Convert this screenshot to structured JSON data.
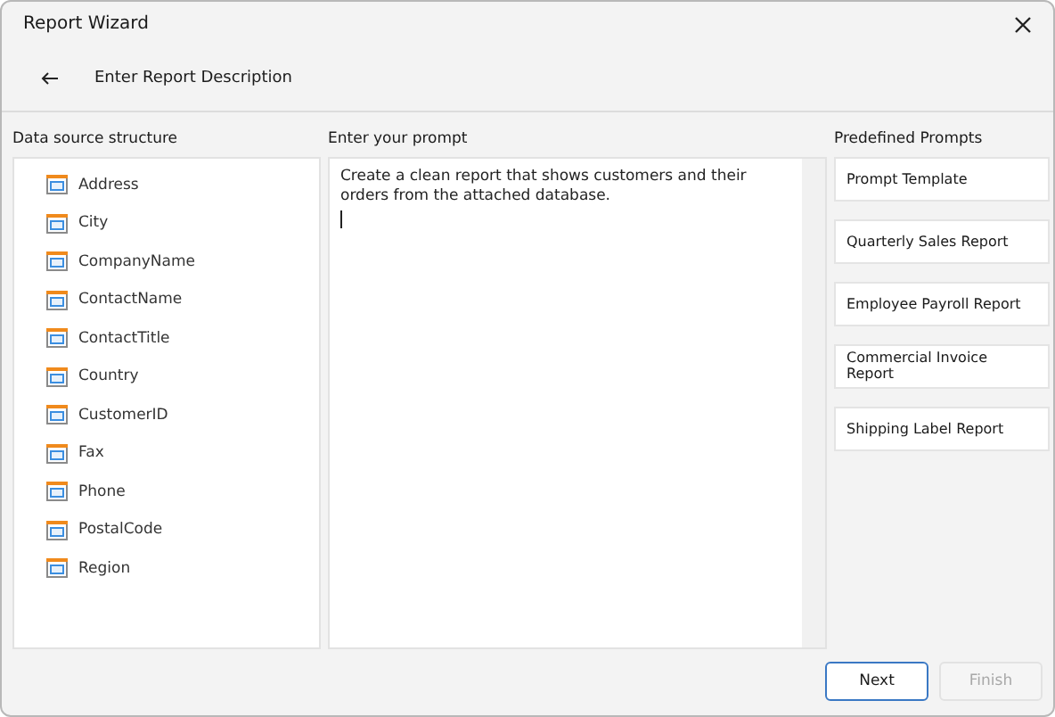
{
  "window": {
    "title": "Report Wizard"
  },
  "header": {
    "title": "Enter Report Description"
  },
  "data_source": {
    "label": "Data source structure",
    "fields": [
      {
        "name": "Address"
      },
      {
        "name": "City"
      },
      {
        "name": "CompanyName"
      },
      {
        "name": "ContactName"
      },
      {
        "name": "ContactTitle"
      },
      {
        "name": "Country"
      },
      {
        "name": "CustomerID"
      },
      {
        "name": "Fax"
      },
      {
        "name": "Phone"
      },
      {
        "name": "PostalCode"
      },
      {
        "name": "Region"
      }
    ]
  },
  "prompt": {
    "label": "Enter your prompt",
    "value": "Create a clean report that shows customers and their orders from the attached database."
  },
  "predefined": {
    "label": "Predefined Prompts",
    "items": [
      {
        "label": "Prompt Template"
      },
      {
        "label": "Quarterly Sales Report"
      },
      {
        "label": "Employee Payroll Report"
      },
      {
        "label": "Commercial Invoice Report"
      },
      {
        "label": "Shipping Label Report"
      }
    ]
  },
  "buttons": [
    {
      "label": "Next",
      "disabled": false,
      "focused": true
    },
    {
      "label": "Finish",
      "disabled": true,
      "focused": false
    }
  ]
}
